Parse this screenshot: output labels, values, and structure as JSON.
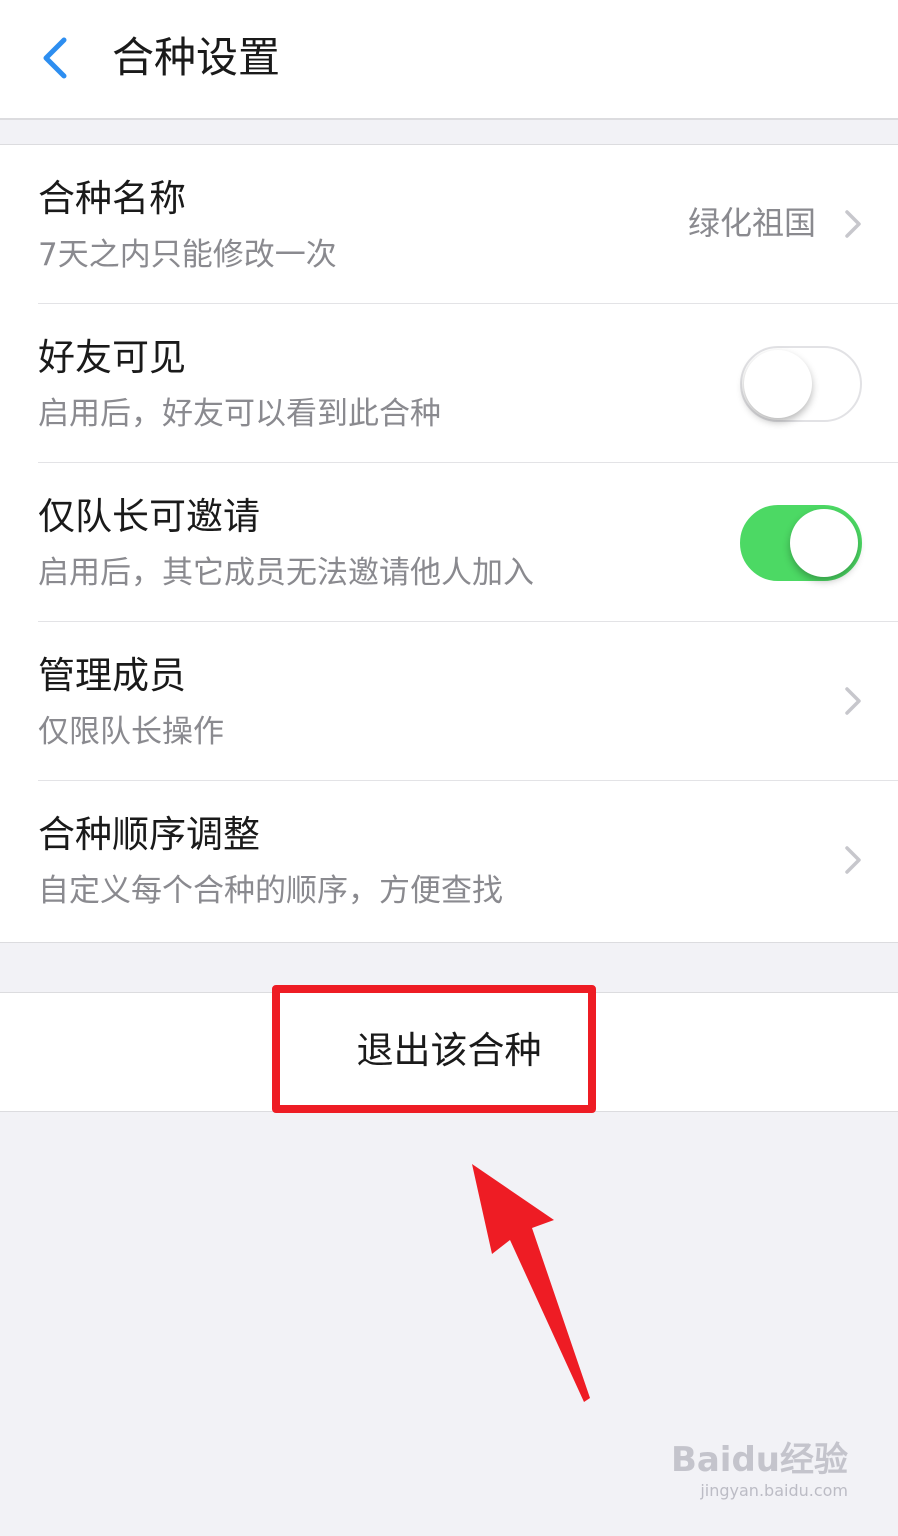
{
  "header": {
    "title": "合种设置"
  },
  "settings": {
    "rows": [
      {
        "title": "合种名称",
        "subtitle": "7天之内只能修改一次",
        "value": "绿化祖国"
      },
      {
        "title": "好友可见",
        "subtitle": "启用后，好友可以看到此合种",
        "toggle": false
      },
      {
        "title": "仅队长可邀请",
        "subtitle": "启用后，其它成员无法邀请他人加入",
        "toggle": true
      },
      {
        "title": "管理成员",
        "subtitle": "仅限队长操作"
      },
      {
        "title": "合种顺序调整",
        "subtitle": "自定义每个合种的顺序，方便查找"
      }
    ]
  },
  "exit": {
    "label": "退出该合种"
  },
  "annotation": {
    "color": "#ee1c24"
  },
  "colors": {
    "accent": "#2d8ef0",
    "switch_on": "#4cd964",
    "background": "#f2f2f6"
  },
  "watermark": {
    "brand": "Baidu经验",
    "url": "jingyan.baidu.com"
  }
}
